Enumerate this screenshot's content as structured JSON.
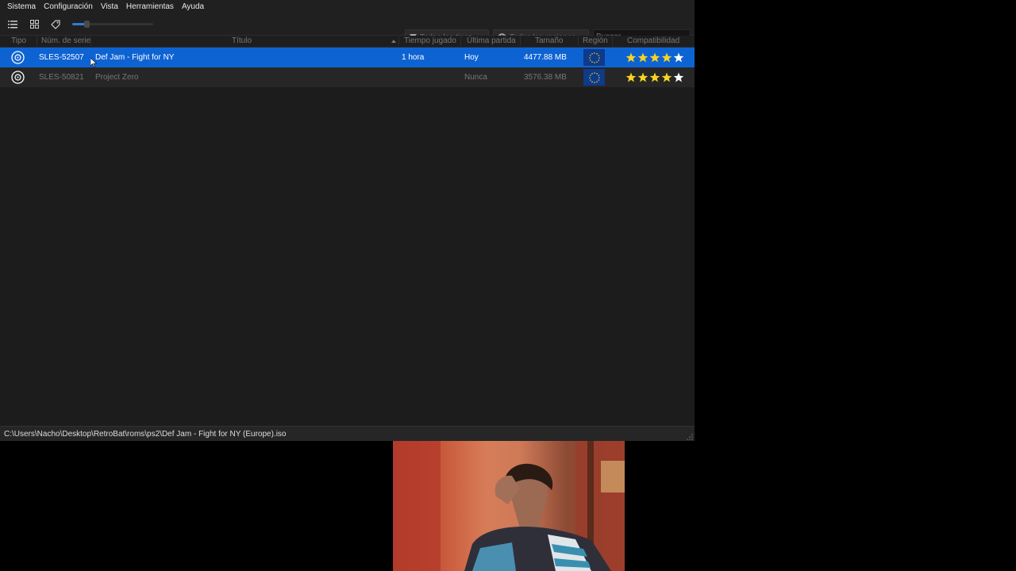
{
  "menu": [
    "Sistema",
    "Configuración",
    "Vista",
    "Herramientas",
    "Ayuda"
  ],
  "toolbar": {
    "list_view_icon": "list-icon",
    "grid_view_icon": "grid-icon",
    "tag_icon": "tag-icon",
    "zoom_level": 0.18,
    "type_filter": "Todos los tipos",
    "region_filter": "Todas las regiones",
    "search_placeholder": "Buscar..."
  },
  "table": {
    "columns": [
      "Tipo",
      "Núm. de serie",
      "Título",
      "Tiempo jugado",
      "Última partida",
      "Tamaño",
      "Región",
      "Compatibilidad"
    ],
    "sorted_column": "Título",
    "rows": [
      {
        "type": "disc-icon",
        "serial": "SLES-52507",
        "title": "Def Jam - Fight for NY",
        "time_played": "1 hora",
        "last_played": "Hoy",
        "size": "4477.88 MB",
        "region": "eu-flag-icon",
        "compat_stars": 5,
        "selected": true
      },
      {
        "type": "disc-icon",
        "serial": "SLES-50821",
        "title": "Project Zero",
        "time_played": "",
        "last_played": "Nunca",
        "size": "3576.38 MB",
        "region": "eu-flag-icon",
        "compat_stars": 5,
        "selected": false
      }
    ]
  },
  "status": {
    "path": "C:\\Users\\Nacho\\Desktop\\RetroBat\\roms\\ps2\\Def Jam - Fight for NY (Europe).iso"
  },
  "colors": {
    "selection": "#0e63d3",
    "background": "#1c1c1c",
    "star_yellow": "#f5d423",
    "star_white": "#ffffff"
  }
}
